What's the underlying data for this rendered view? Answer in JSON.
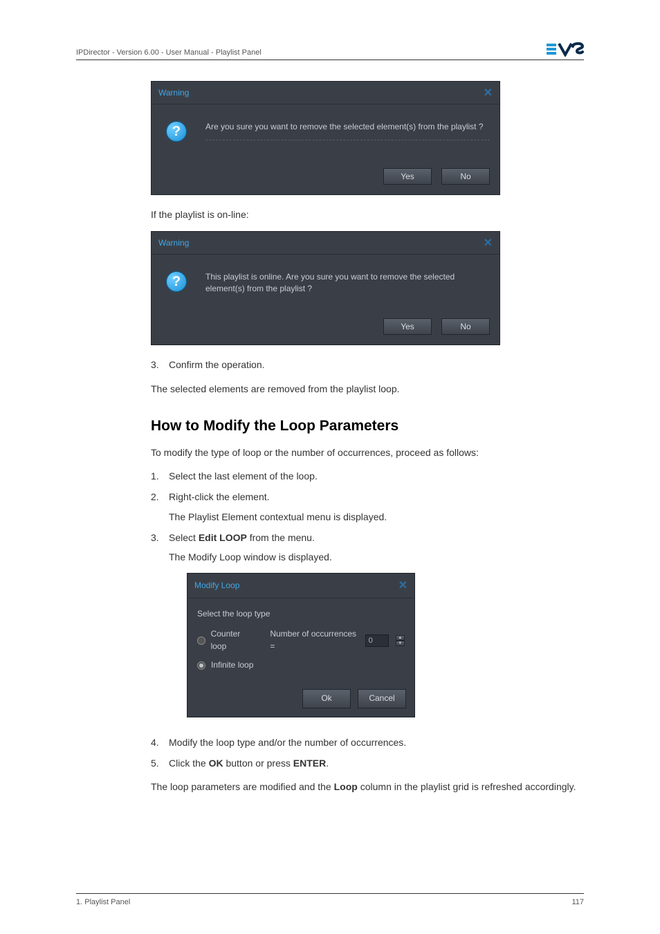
{
  "header": {
    "text": "IPDirector - Version 6.00 - User Manual - Playlist Panel"
  },
  "dialog1": {
    "title": "Warning",
    "message": "Are you sure you want to remove the selected element(s) from the playlist ?",
    "yes": "Yes",
    "no": "No"
  },
  "caption1": "If the playlist is on-line:",
  "dialog2": {
    "title": "Warning",
    "message": "This playlist is online. Are you sure you want to remove the selected element(s) from the playlist ?",
    "yes": "Yes",
    "no": "No"
  },
  "step3": {
    "num": "3.",
    "text": "Confirm the operation."
  },
  "result1": "The selected elements are removed from the playlist loop.",
  "sectionTitle": "How to Modify the Loop Parameters",
  "intro2": "To modify the type of loop or the number of occurrences, proceed as follows:",
  "steps2": {
    "s1": {
      "num": "1.",
      "text": "Select the last element of the loop."
    },
    "s2": {
      "num": "2.",
      "text": "Right-click the element.",
      "sub": "The Playlist Element contextual menu is displayed."
    },
    "s3": {
      "num": "3.",
      "text_pre": "Select ",
      "bold": "Edit LOOP",
      "text_post": " from the menu.",
      "sub": "The Modify Loop window is displayed."
    },
    "s4": {
      "num": "4.",
      "text": "Modify the loop type and/or the number of occurrences."
    },
    "s5": {
      "num": "5.",
      "text_pre": "Click the ",
      "bold": "OK",
      "text_mid": " button or press ",
      "bold2": "ENTER",
      "text_post": "."
    }
  },
  "modifyDialog": {
    "title": "Modify Loop",
    "selectLabel": "Select the loop type",
    "counter": "Counter loop",
    "occLabel": "Number of occurrences =",
    "occValue": "0",
    "infinite": "Infinite loop",
    "ok": "Ok",
    "cancel": "Cancel"
  },
  "result2_pre": "The loop parameters are modified and the ",
  "result2_bold": "Loop",
  "result2_post": " column in the playlist grid is refreshed accordingly.",
  "footer": {
    "left": "1. Playlist Panel",
    "right": "117"
  }
}
